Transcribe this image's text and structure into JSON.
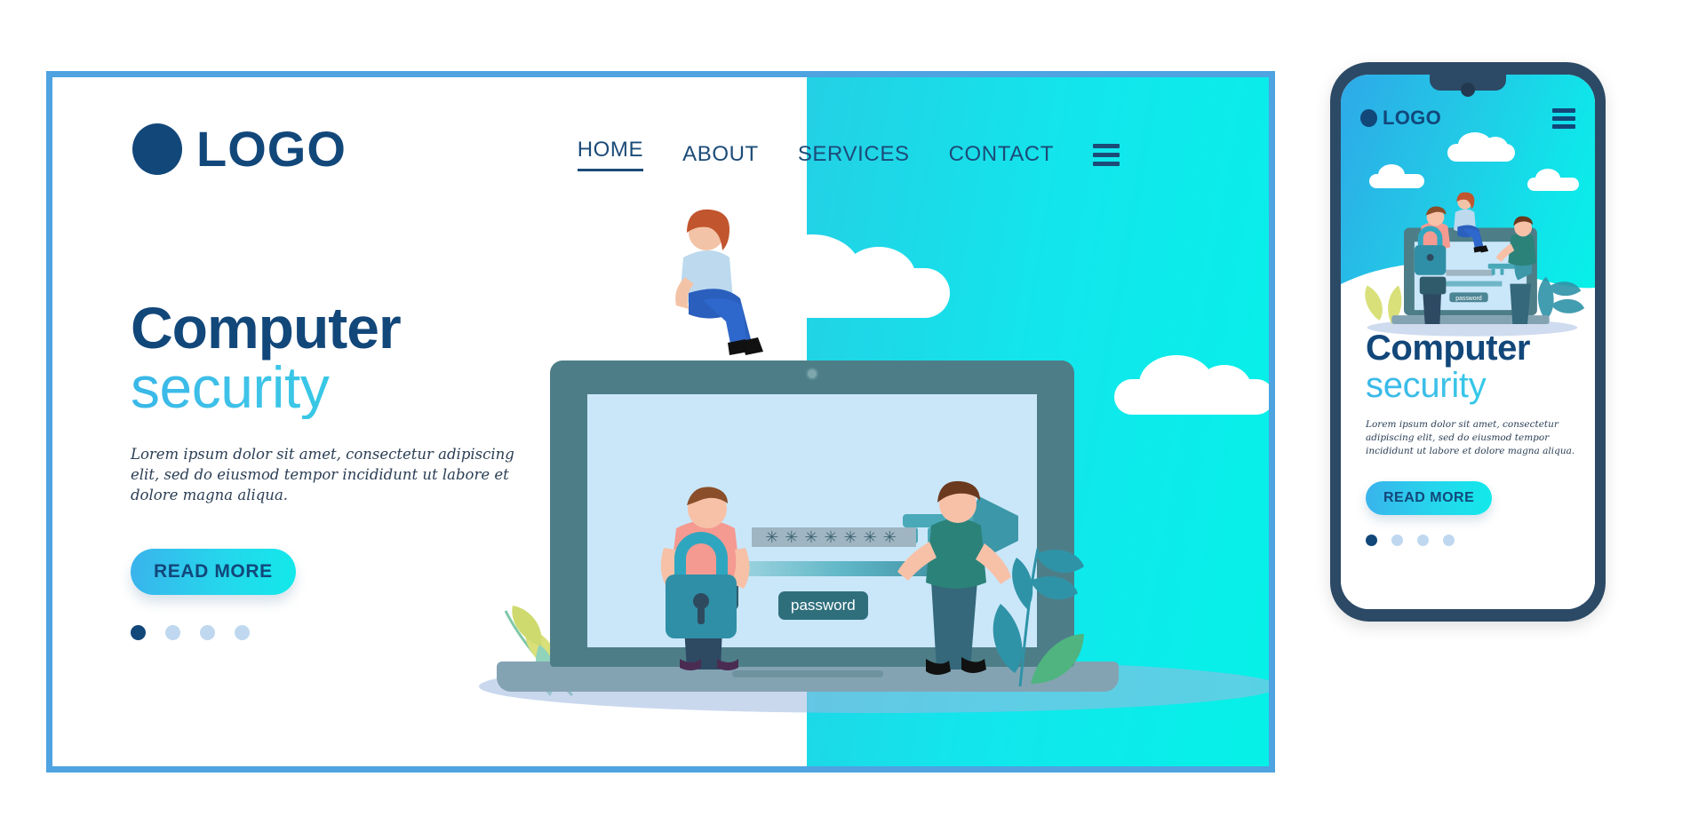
{
  "brand": {
    "logo_text": "LOGO",
    "logo_mark": "circle-dot",
    "navy": "#12477a",
    "cyan": "#12e6ec",
    "blue": "#35b6ee",
    "border": "#4ea3e0"
  },
  "desktop": {
    "nav": {
      "items": [
        {
          "label": "HOME",
          "active": true
        },
        {
          "label": "ABOUT",
          "active": false
        },
        {
          "label": "SERVICES",
          "active": false
        },
        {
          "label": "CONTACT",
          "active": false
        }
      ],
      "menu_icon": "hamburger-icon"
    },
    "hero": {
      "title_line1": "Computer",
      "title_line2": "security",
      "paragraph": "Lorem ipsum dolor sit amet, consectetur adipiscing elit, sed do eiusmod tempor incididunt ut labore et dolore magna aliqua.",
      "cta_label": "READ MORE",
      "dots": [
        {
          "active": true
        },
        {
          "active": false
        },
        {
          "active": false
        },
        {
          "active": false
        }
      ]
    },
    "illustration": {
      "password_mask": "✳✳✳✳✳✳✳",
      "password_tag": "password",
      "elements": [
        "laptop",
        "woman-sitting-on-laptop",
        "man-holding-padlock",
        "woman-holding-key",
        "clouds",
        "leaves"
      ]
    }
  },
  "mobile": {
    "logo_text": "LOGO",
    "menu_icon": "hamburger-icon",
    "hero": {
      "title_line1": "Computer",
      "title_line2": "security",
      "paragraph": "Lorem ipsum dolor sit amet, consectetur adipiscing elit, sed do eiusmod tempor incididunt ut labore et dolore magna aliqua.",
      "cta_label": "READ MORE",
      "dots": [
        {
          "active": true
        },
        {
          "active": false
        },
        {
          "active": false
        },
        {
          "active": false
        }
      ]
    },
    "illustration": {
      "password_tag": "password"
    }
  }
}
